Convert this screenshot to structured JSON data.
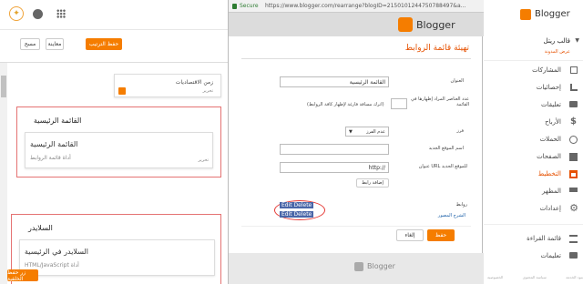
{
  "left": {
    "save_arrangement": "حفظ الترتيب",
    "preview": "معاينة",
    "clear": "مسح",
    "stats_gadget": {
      "title": "زمن الاقتصاديات",
      "edit": "تحرير"
    },
    "main_list_section": "القائمة الرئيسية",
    "main_list_gadget": {
      "title": "القائمة الرئيسية",
      "subtitle": "أداة قائمة الروابط",
      "edit": "تحرير"
    },
    "slider_section": "السلايدر",
    "slider_gadget": {
      "title": "السلايدر في الرئيسية",
      "subtitle": "HTML/JavaScript أداة"
    },
    "save_bottom": "زر حفظ الخلفية"
  },
  "popup": {
    "secure": "Secure",
    "url": "https://www.blogger.com/rearrange?blogID=2150101244750788497&a...",
    "brand": "Blogger",
    "page_title": "تهيئة قائمة الروابط",
    "title_label": "العنوان",
    "title_value": "القائمة الرئيسية",
    "max_label": "عدد العناصر المراد إظهارها في القائمة",
    "max_hint": "(اترك مسافة فارغة لإظهار كافة الروابط)",
    "sort_label": "فرز",
    "sort_value": "عدم الفرز",
    "new_name_label": "اسم الموقع الجديد",
    "new_url_label": "عنوان URL للموقع الجديد",
    "url_value": "http://",
    "add_link": "إضافة رابط",
    "links_label": "روابط",
    "edit_delete_1": "Edit Delete",
    "edit_delete_2": "Edit Delete",
    "link_1": "",
    "link_2": "الشرح المصور",
    "save": "حفظ",
    "cancel": "إلغاء",
    "footer_brand": "Blogger"
  },
  "right": {
    "brand": "Blogger",
    "blog_name": "قالب ريتل",
    "view_blog": "عرض المدونة",
    "nav": [
      {
        "label": "المشاركات",
        "icon": "posts-icon",
        "active": false
      },
      {
        "label": "إحصائيات",
        "icon": "stats-icon",
        "active": false
      },
      {
        "label": "تعليقات",
        "icon": "comments-icon",
        "active": false
      },
      {
        "label": "الأرباح",
        "icon": "earnings-icon",
        "active": false
      },
      {
        "label": "الحملات",
        "icon": "campaigns-icon",
        "active": false
      },
      {
        "label": "الصفحات",
        "icon": "pages-icon",
        "active": false
      },
      {
        "label": "التخطيط",
        "icon": "layout-icon",
        "active": true
      },
      {
        "label": "المظهر",
        "icon": "theme-icon",
        "active": false
      },
      {
        "label": "إعدادات",
        "icon": "settings-icon",
        "active": false
      }
    ],
    "reading_list": "قائمة القراءة",
    "help": "تعليمات",
    "footer": [
      "الخصوصية",
      "سياسة المحتوى",
      "بنود الخدمة"
    ]
  },
  "colors": {
    "accent": "#f57d00",
    "active_text": "#e65100",
    "red_outline": "#e57373"
  }
}
